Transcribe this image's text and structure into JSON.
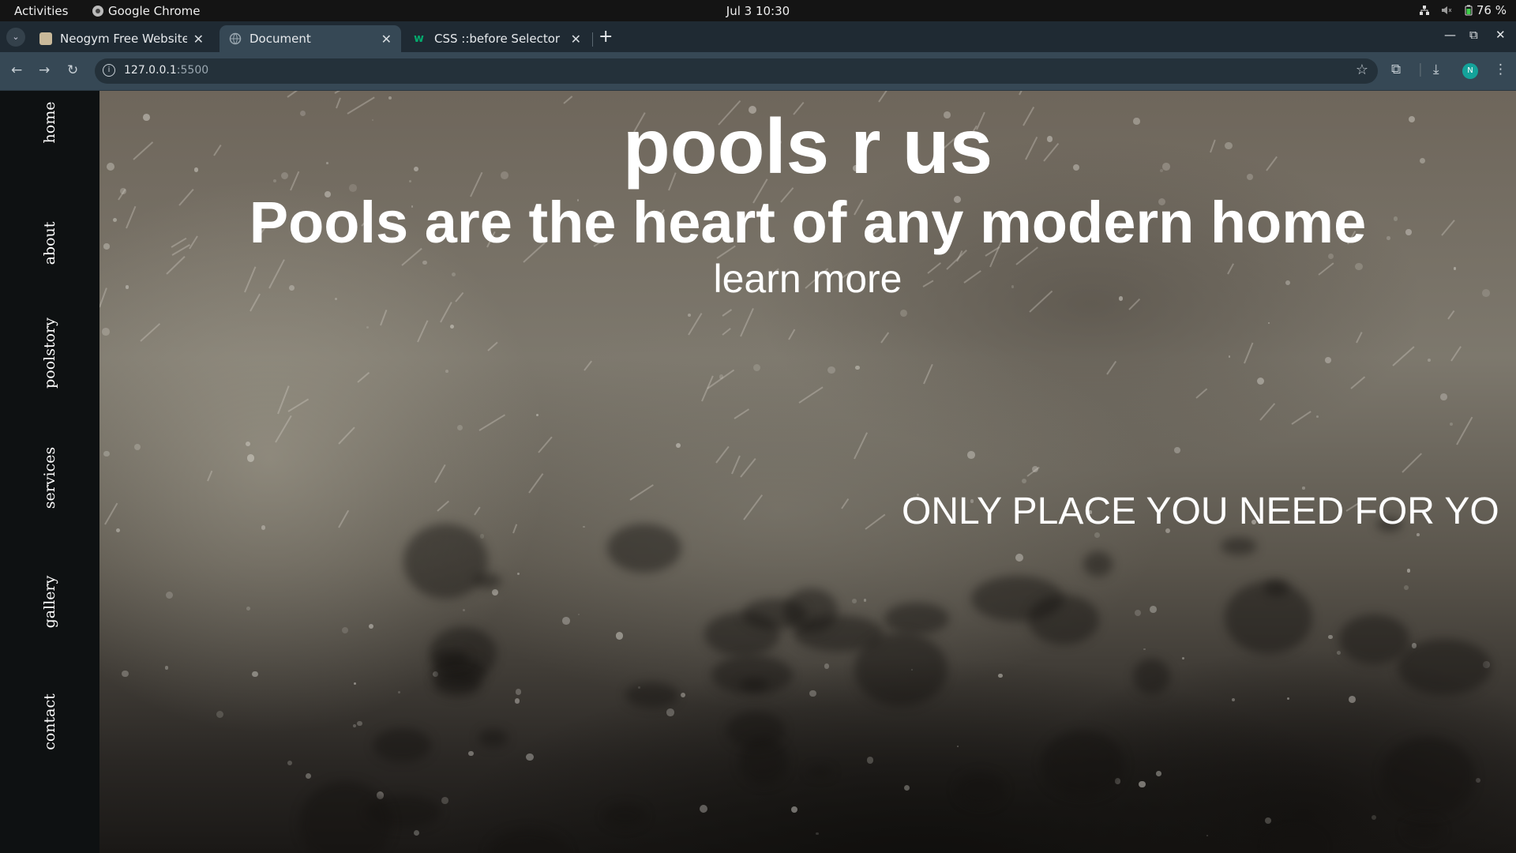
{
  "system_bar": {
    "activities": "Activities",
    "app_name": "Google Chrome",
    "clock": "Jul 3  10:30",
    "battery": "76 %"
  },
  "browser": {
    "tabs": [
      {
        "title": "Neogym Free Website Te",
        "favicon": "image-favicon",
        "active": false
      },
      {
        "title": "Document",
        "favicon": "globe-favicon",
        "active": true
      },
      {
        "title": "CSS ::before Selector",
        "favicon": "w3schools-favicon",
        "active": false
      }
    ],
    "new_tab": "+",
    "url_host": "127.0.0.1",
    "url_port": ":5500",
    "profile_initial": "N"
  },
  "page": {
    "nav": [
      "home",
      "about",
      "poolstory",
      "services",
      "gallery",
      "contact"
    ],
    "hero": {
      "title": "pools r us",
      "subtitle": "Pools are the heart of any modern home",
      "link": "learn more",
      "marquee": "ONLY PLACE YOU NEED FOR YO"
    }
  },
  "colors": {
    "sidebar_bg": "#0e1112",
    "tab_strip_bg": "#1f2a33",
    "toolbar_bg": "#364855",
    "text": "#ffffff"
  }
}
